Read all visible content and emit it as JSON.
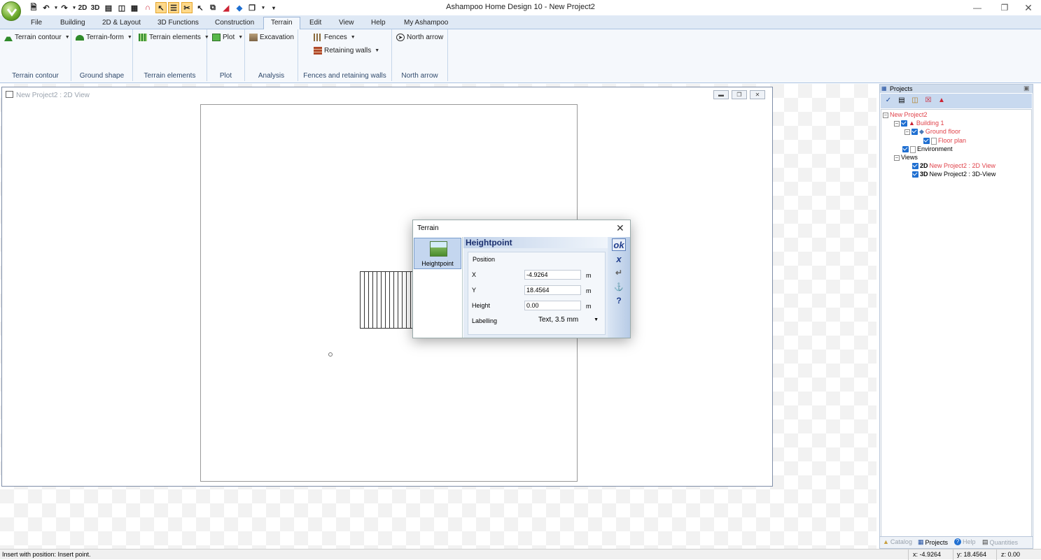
{
  "app": {
    "title": "Ashampoo Home Design 10 - New Project2"
  },
  "quick_access": {
    "btn_2d": "2D",
    "btn_3d": "3D"
  },
  "menu": {
    "tabs": [
      "File",
      "Building",
      "2D & Layout",
      "3D Functions",
      "Construction",
      "Terrain",
      "Edit",
      "View",
      "Help",
      "My Ashampoo"
    ],
    "active": "Terrain"
  },
  "ribbon": {
    "groups": [
      {
        "label": "Terrain contour",
        "button": "Terrain contour"
      },
      {
        "label": "Ground shape",
        "button": "Terrain-form"
      },
      {
        "label": "Terrain elements",
        "button": "Terrain elements"
      },
      {
        "label": "Plot",
        "button": "Plot"
      },
      {
        "label": "Analysis",
        "button": "Excavation"
      },
      {
        "label": "Fences and retaining walls",
        "buttons": [
          "Fences",
          "Retaining walls"
        ]
      },
      {
        "label": "North arrow",
        "button": "North arrow"
      }
    ]
  },
  "doc": {
    "title": "New Project2 : 2D View"
  },
  "dialog": {
    "title": "Terrain",
    "list_item": "Heightpoint",
    "header": "Heightpoint",
    "group": "Position",
    "fields": [
      {
        "label": "X",
        "value": "-4.9264",
        "unit": "m"
      },
      {
        "label": "Y",
        "value": "18.4564",
        "unit": "m"
      },
      {
        "label": "Height",
        "value": "0.00",
        "unit": "m"
      }
    ],
    "labelling": {
      "label": "Labelling",
      "value": "Text, 3.5 mm"
    },
    "side": {
      "ok": "ok",
      "cancel": "x",
      "help": "?"
    }
  },
  "projects": {
    "title": "Projects",
    "tree": {
      "root": "New Project2",
      "building": "Building 1",
      "floor": "Ground floor",
      "plan": "Floor plan",
      "environment": "Environment",
      "views": "Views",
      "view2d_prefix": "2D",
      "view2d": "New Project2 : 2D View",
      "view3d_prefix": "3D",
      "view3d": "New Project2 : 3D-View"
    },
    "tabs": [
      "Catalog",
      "Projects",
      "Help",
      "Quantities"
    ],
    "active_tab": "Projects"
  },
  "status": {
    "message": "Insert with position: Insert point.",
    "x": "x: -4.9264",
    "y": "y: 18.4564",
    "z": "z: 0.00"
  },
  "colors": {
    "accent": "#1f6fd1",
    "highlight": "#e0424a",
    "ribbon_bg": "#f5f8fc"
  }
}
